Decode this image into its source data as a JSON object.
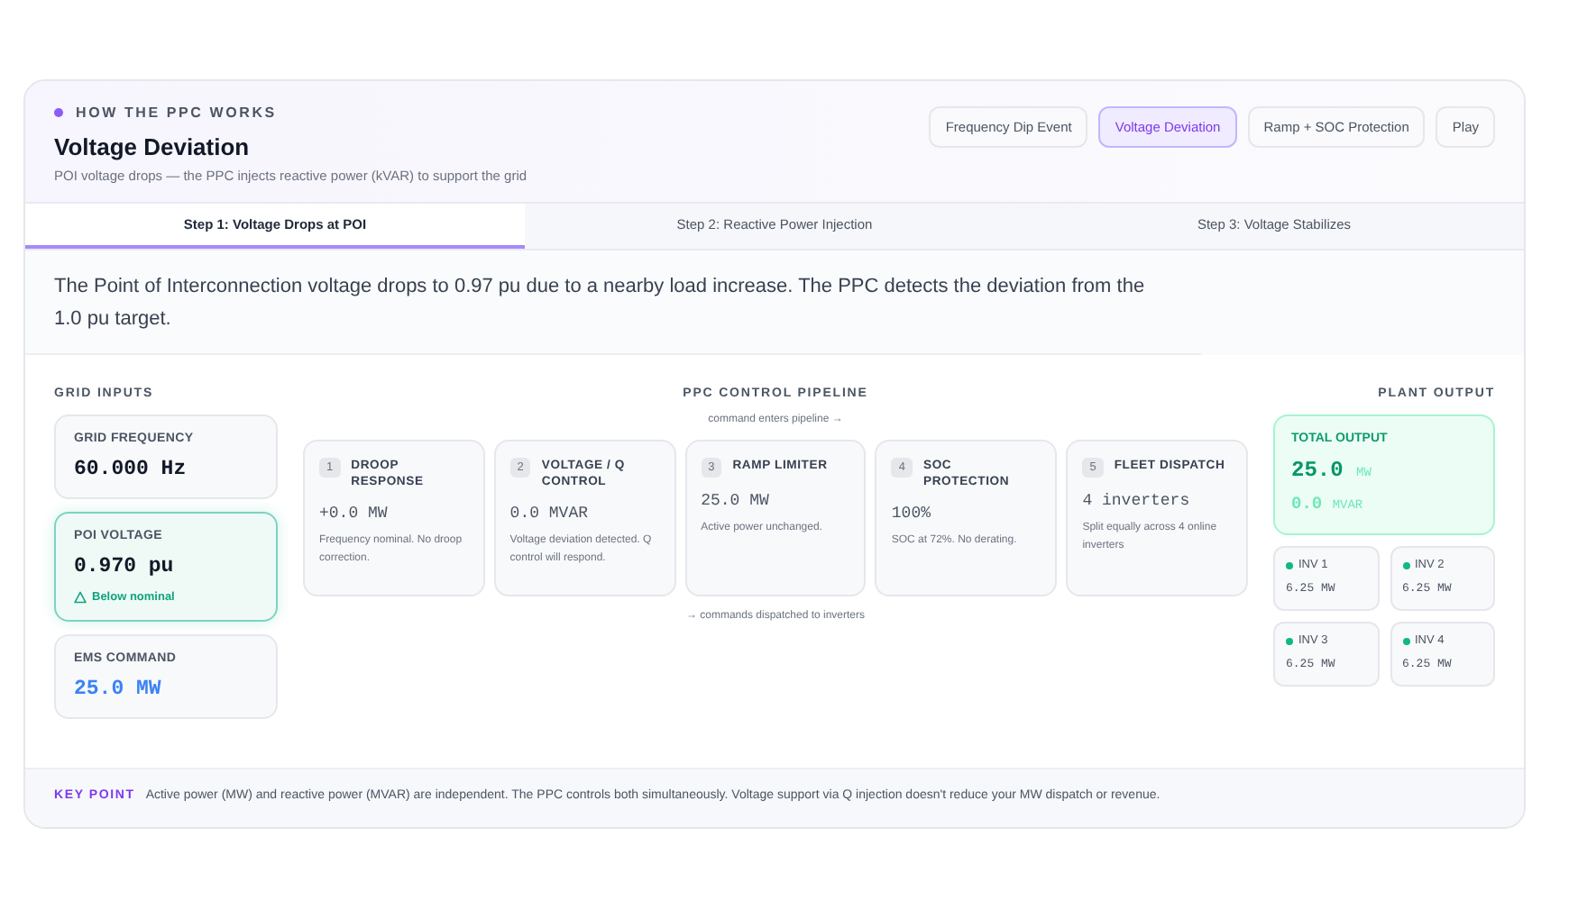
{
  "header": {
    "eyebrow": "HOW THE PPC WORKS",
    "title": "Voltage Deviation",
    "subtitle": "POI voltage drops — the PPC injects reactive power (kVAR) to support the grid"
  },
  "scenarios": [
    {
      "label": "Frequency Dip Event",
      "selected": false
    },
    {
      "label": "Voltage Deviation",
      "selected": true
    },
    {
      "label": "Ramp + SOC Protection",
      "selected": false
    },
    {
      "label": "Play",
      "selected": false
    }
  ],
  "steps": [
    {
      "label": "Step 1: Voltage Drops at POI",
      "selected": true
    },
    {
      "label": "Step 2: Reactive Power Injection",
      "selected": false
    },
    {
      "label": "Step 3: Voltage Stabilizes",
      "selected": false
    }
  ],
  "description": "The Point of Interconnection voltage drops to 0.97 pu due to a nearby load increase. The PPC detects the deviation from the 1.0 pu target.",
  "grid_inputs": {
    "heading": "GRID INPUTS",
    "items": [
      {
        "kind": "plain",
        "label": "GRID FREQUENCY",
        "value": "60.000 Hz"
      },
      {
        "kind": "alert",
        "label": "POI VOLTAGE",
        "value": "0.970 pu",
        "alert": "Below nominal"
      },
      {
        "kind": "command",
        "label": "EMS COMMAND",
        "value": "25.0 MW"
      }
    ]
  },
  "pipeline": {
    "heading": "PPC CONTROL PIPELINE",
    "enter_note": "command enters pipeline →",
    "exit_note": "→ commands dispatched to inverters",
    "stages": [
      {
        "number": "1",
        "title": "DROOP RESPONSE",
        "value": "+0.0 MW",
        "note": "Frequency nominal. No droop correction."
      },
      {
        "number": "2",
        "title": "VOLTAGE / Q CONTROL",
        "value": "0.0 MVAR",
        "note": "Voltage deviation detected. Q control will respond."
      },
      {
        "number": "3",
        "title": "RAMP LIMITER",
        "value": "25.0 MW",
        "note": "Active power unchanged."
      },
      {
        "number": "4",
        "title": "SOC PROTECTION",
        "value": "100%",
        "note": "SOC at 72%. No derating."
      },
      {
        "number": "5",
        "title": "FLEET DISPATCH",
        "value": "4 inverters",
        "note": "Split equally across 4 online inverters"
      }
    ]
  },
  "plant_output": {
    "heading": "PLANT OUTPUT",
    "total": {
      "label": "TOTAL OUTPUT",
      "mw_value": "25.0",
      "mw_unit": "MW",
      "mvar_value": "0.0",
      "mvar_unit": "MVAR"
    },
    "inverters": [
      {
        "name": "INV 1",
        "value": "6.25 MW",
        "online": true
      },
      {
        "name": "INV 2",
        "value": "6.25 MW",
        "online": true
      },
      {
        "name": "INV 3",
        "value": "6.25 MW",
        "online": true
      },
      {
        "name": "INV 4",
        "value": "6.25 MW",
        "online": true
      }
    ]
  },
  "key_point": {
    "label": "KEY POINT",
    "text": "Active power (MW) and reactive power (MVAR) are independent. The PPC controls both simultaneously. Voltage support via Q injection doesn't reduce your MW dispatch or revenue."
  }
}
